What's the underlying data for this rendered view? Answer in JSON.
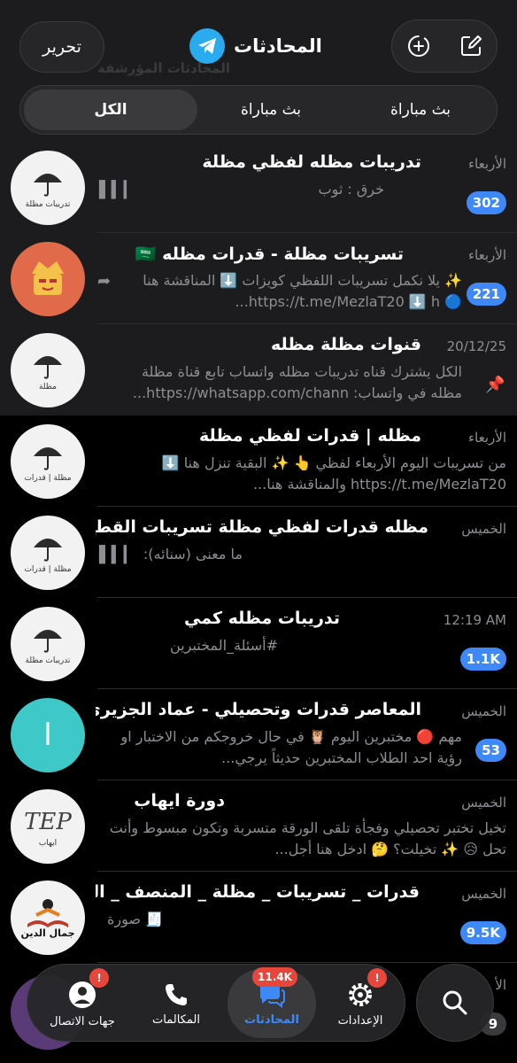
{
  "header": {
    "edit_label": "تحرير",
    "title": "المحادثات",
    "ghost_folder": "المحادثات المؤرشفة"
  },
  "filters": {
    "all": "الكل",
    "broadcast_1": "بث مباراة",
    "broadcast_2": "بث مباراة"
  },
  "chats": [
    {
      "title": "تدريبات مظله لفظي مظلة",
      "date": "الأربعاء",
      "preview": "خرق : ثوب",
      "badge": "302",
      "avatar_caption": "تدريبات مظلة"
    },
    {
      "title": "تسريبات مظلة - قدرات مظله 🇸🇦",
      "date": "الأربعاء",
      "preview": "✨ يلا نكمل تسريبات اللفظي كويزات ⬇️ المناقشة هنا 🔵 https://t.me/MezlaT20 ⬇️ h...",
      "badge": "221"
    },
    {
      "title": "قنوات مظلة مظله",
      "date": "20/12/25",
      "preview": "الكل يشترك قناه تدريبات مظله واتساب تابع قناة مظلة مظله في واتساب: https://whatsapp.com/chann...",
      "avatar_caption": "مظلة"
    },
    {
      "title": "مظله | قدرات لفظي مظلة",
      "date": "الأربعاء",
      "preview": "من تسريبات اليوم الأربعاء لفظي 👆 ✨ البقية تنزل هنا ⬇️ https://t.me/MezlaT20 والمناقشة هنا...",
      "avatar_caption": "مظلة | قدرات"
    },
    {
      "title": "مظله قدرات لفظي مظلة تسريبات القطع.",
      "date": "الخميس",
      "preview": "ما معنى (سنائه):",
      "avatar_caption": "مظلة | قدرات"
    },
    {
      "title": "تدريبات مظله كمي",
      "date": "12:19 AM",
      "preview": "#أسئلة_المختبرين",
      "badge": "1.1K",
      "avatar_caption": "تدريبات مظلة"
    },
    {
      "title": "المعاصر قدرات وتحصيلي - عماد الجزيري",
      "date": "الخميس",
      "preview": "مهم 🔴 مختبرين اليوم 🦉 في حال خروجكم من الاختبار او رؤية احد الطلاب المختبرين حديثاً يرجي...",
      "badge": "53",
      "avatar_letter": "ا"
    },
    {
      "title": "دورة ايهاب",
      "date": "الخميس",
      "preview": "تخيل تختبر تحصيلي وفجأة تلقى الورقة متسربة وتكون مبسوط وأنت تحل 😥 ✨ تخيلت؟ 🤔 ادخل هنا أجل...",
      "avatar_caption": "ايهاب",
      "avatar_mark": "TEP"
    },
    {
      "title": "قدرات _ تسريبات _ مظلة _ المنصف _ الم",
      "date": "الخميس",
      "preview": "🧾 صورة",
      "badge": "9.5K",
      "avatar_caption": "جمال الدين"
    },
    {
      "title": "",
      "date": "الأ",
      "preview": "",
      "badge": "9"
    }
  ],
  "tabbar": {
    "contacts": "جهات الاتصال",
    "calls": "المكالمات",
    "chats": "المحادثات",
    "settings": "الإعدادات",
    "chats_badge": "11.4K",
    "contacts_badge": "!",
    "settings_badge": "!"
  },
  "colors": {
    "accent": "#3e88f7",
    "badge_red": "#e6463c",
    "header_bg": "#1c1c1e"
  }
}
